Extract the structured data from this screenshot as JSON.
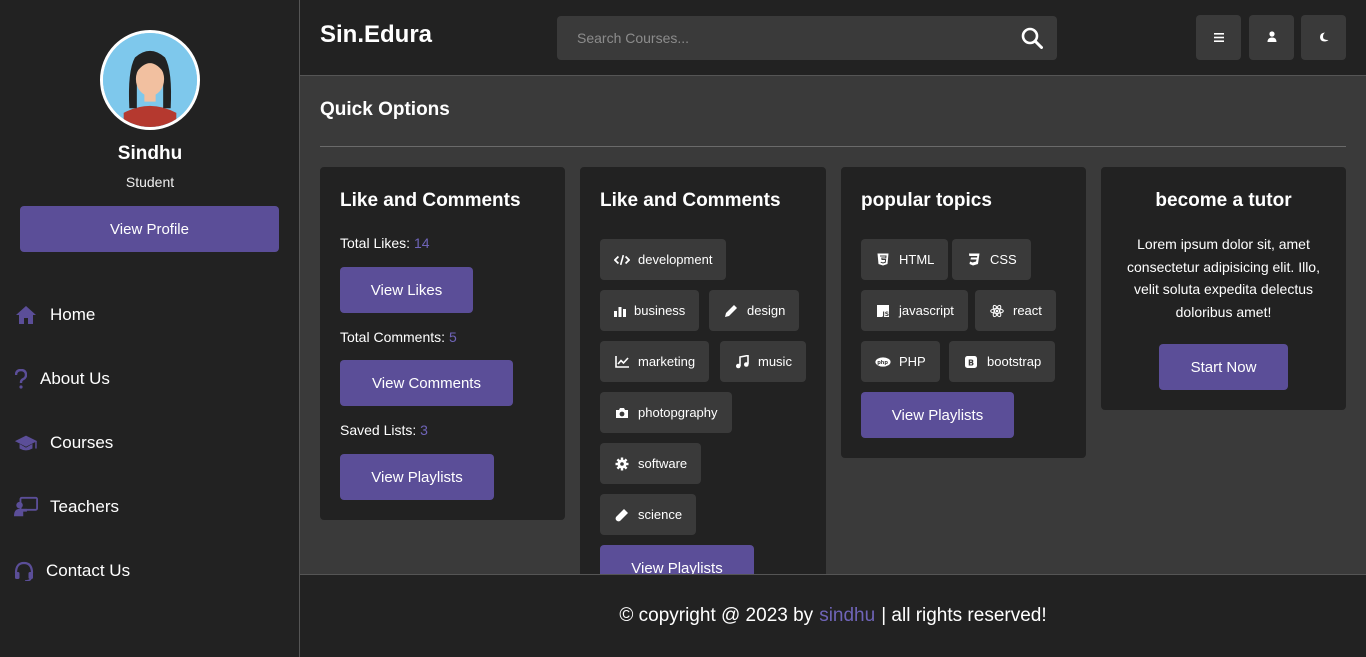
{
  "brand": {
    "logo": "Sin.Edura",
    "accent": "#5b4e98",
    "accent_text": "#6f64b8"
  },
  "search": {
    "placeholder": "Search Courses..."
  },
  "header_buttons": [
    {
      "icon": "menu-icon"
    },
    {
      "icon": "user-icon"
    },
    {
      "icon": "moon-icon"
    }
  ],
  "profile": {
    "name": "Sindhu",
    "role": "Student",
    "button": "View Profile"
  },
  "sidebar": {
    "items": [
      {
        "label": "Home",
        "icon": "home-icon"
      },
      {
        "label": "About Us",
        "icon": "question-icon"
      },
      {
        "label": "Courses",
        "icon": "graduation-cap-icon"
      },
      {
        "label": "Teachers",
        "icon": "teacher-icon"
      },
      {
        "label": "Contact Us",
        "icon": "headset-icon"
      }
    ]
  },
  "main": {
    "section_title": "Quick Options",
    "cards": {
      "likes": {
        "title": "Like and Comments",
        "total_likes_label": "Total Likes:",
        "total_likes": "14",
        "view_likes": "View Likes",
        "total_comments_label": "Total Comments:",
        "total_comments": "5",
        "view_comments": "View Comments",
        "saved_lists_label": "Saved Lists:",
        "saved_lists": "3",
        "view_playlists": "View Playlists"
      },
      "categories": {
        "title": "Like and Comments",
        "tags": [
          {
            "label": "development",
            "icon": "code-icon"
          },
          {
            "label": "business",
            "icon": "bar-chart-icon"
          },
          {
            "label": "design",
            "icon": "pencil-icon"
          },
          {
            "label": "marketing",
            "icon": "line-chart-icon"
          },
          {
            "label": "music",
            "icon": "music-icon"
          },
          {
            "label": "photopgraphy",
            "icon": "camera-icon"
          },
          {
            "label": "software",
            "icon": "gear-icon"
          },
          {
            "label": "science",
            "icon": "vial-icon"
          }
        ],
        "button": "View Playlists"
      },
      "topics": {
        "title": "popular topics",
        "tags": [
          {
            "label": "HTML",
            "icon": "html5-icon"
          },
          {
            "label": "CSS",
            "icon": "css3-icon"
          },
          {
            "label": "javascript",
            "icon": "js-icon"
          },
          {
            "label": "react",
            "icon": "react-icon"
          },
          {
            "label": "PHP",
            "icon": "php-icon"
          },
          {
            "label": "bootstrap",
            "icon": "bootstrap-icon"
          }
        ],
        "button": "View Playlists"
      },
      "tutor": {
        "title": "become a tutor",
        "text": "Lorem ipsum dolor sit, amet consectetur adipisicing elit. Illo, velit soluta expedita delectus doloribus amet!",
        "button": "Start Now"
      }
    }
  },
  "footer": {
    "prefix": "© copyright @ 2023 by",
    "author": "sindhu",
    "suffix": "| all rights reserved!"
  }
}
